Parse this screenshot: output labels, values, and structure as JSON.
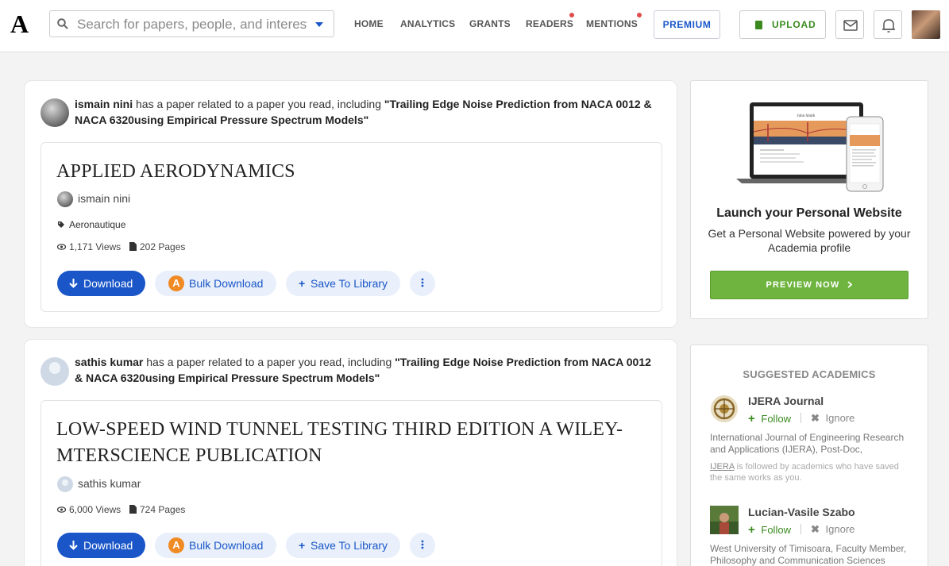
{
  "header": {
    "logo": "A",
    "search_placeholder": "Search for papers, people, and interests",
    "nav": [
      {
        "label": "HOME"
      },
      {
        "label": "ANALYTICS"
      },
      {
        "label": "GRANTS"
      },
      {
        "label": "READERS"
      },
      {
        "label": "MENTIONS"
      }
    ],
    "premium_label": "PREMIUM",
    "upload_label": "UPLOAD"
  },
  "feed": [
    {
      "user": "ismain nini",
      "notice_mid": " has a paper related to a paper you read, including ",
      "related_title": "\"Trailing Edge Noise Prediction from NACA 0012 & NACA 6320using Empirical Pressure Spectrum Models\"",
      "paper_title": "APPLIED AERODYNAMICS",
      "author": "ismain nini",
      "tag": "Aeronautique",
      "views": "1,171 Views",
      "pages": "202 Pages",
      "download_label": "Download",
      "bulk_label": "Bulk Download",
      "save_label": "Save To Library"
    },
    {
      "user": "sathis kumar",
      "notice_mid": " has a paper related to a paper you read, including ",
      "related_title": "\"Trailing Edge Noise Prediction from NACA 0012 & NACA 6320using Empirical Pressure Spectrum Models\"",
      "paper_title": "LOW-SPEED WIND TUNNEL TESTING THIRD EDITION A WILEY-MTERSCIENCE PUBLICATION",
      "author": "sathis kumar",
      "views": "6,000 Views",
      "pages": "724 Pages",
      "download_label": "Download",
      "bulk_label": "Bulk Download",
      "save_label": "Save To Library"
    }
  ],
  "website_promo": {
    "mock_name": "John Smith",
    "title": "Launch your Personal Website",
    "description": "Get a Personal Website powered by your Academia profile",
    "button_label": "PREVIEW NOW"
  },
  "suggested": {
    "title": "SUGGESTED ACADEMICS",
    "follow_label": "Follow",
    "ignore_label": "Ignore",
    "items": [
      {
        "name": "IJERA Journal",
        "description": "International Journal of Engineering Research and Applications (IJERA), Post-Doc, Engineeri…",
        "note_link": "IJERA",
        "note_rest": " is followed by academics who have saved the same works as you."
      },
      {
        "name": "Lucian-Vasile Szabo",
        "description": "West University of Timisoara, Faculty Member, Philosophy and Communication Sciences"
      }
    ]
  },
  "colors": {
    "brand_blue": "#1a56c8",
    "green": "#6eb43f",
    "notification_dot": "#e04c4c"
  }
}
